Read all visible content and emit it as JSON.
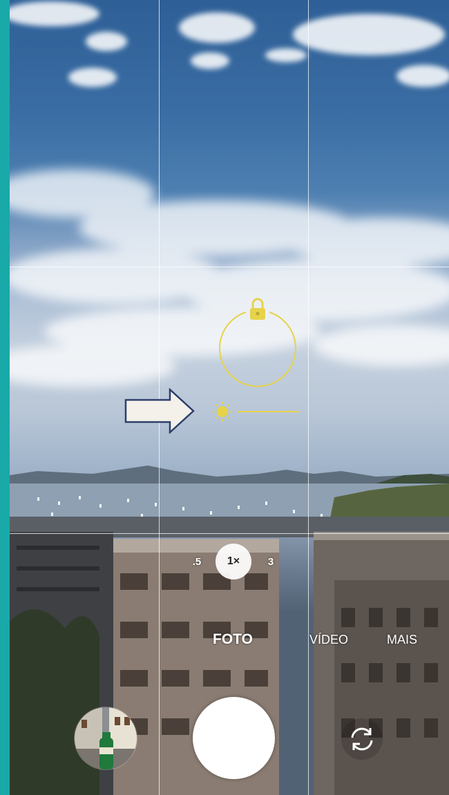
{
  "zoom": {
    "options": [
      ".5",
      "1×",
      "3"
    ],
    "selected": "1×"
  },
  "modes": {
    "items": [
      "FOTO",
      "VÍDEO",
      "MAIS"
    ],
    "selected": "FOTO"
  },
  "controls": {
    "shutter": "shutter-button",
    "gallery": "gallery-thumbnail",
    "flip": "switch-camera-button"
  },
  "focus": {
    "lock_icon": "lock-icon",
    "exposure_icon": "sun-icon",
    "color": "#e6d34a"
  },
  "colors": {
    "edge_accent": "#19a9a8",
    "annotation_arrow_fill": "#f3f1ea",
    "annotation_arrow_stroke": "#2d3f6b"
  }
}
